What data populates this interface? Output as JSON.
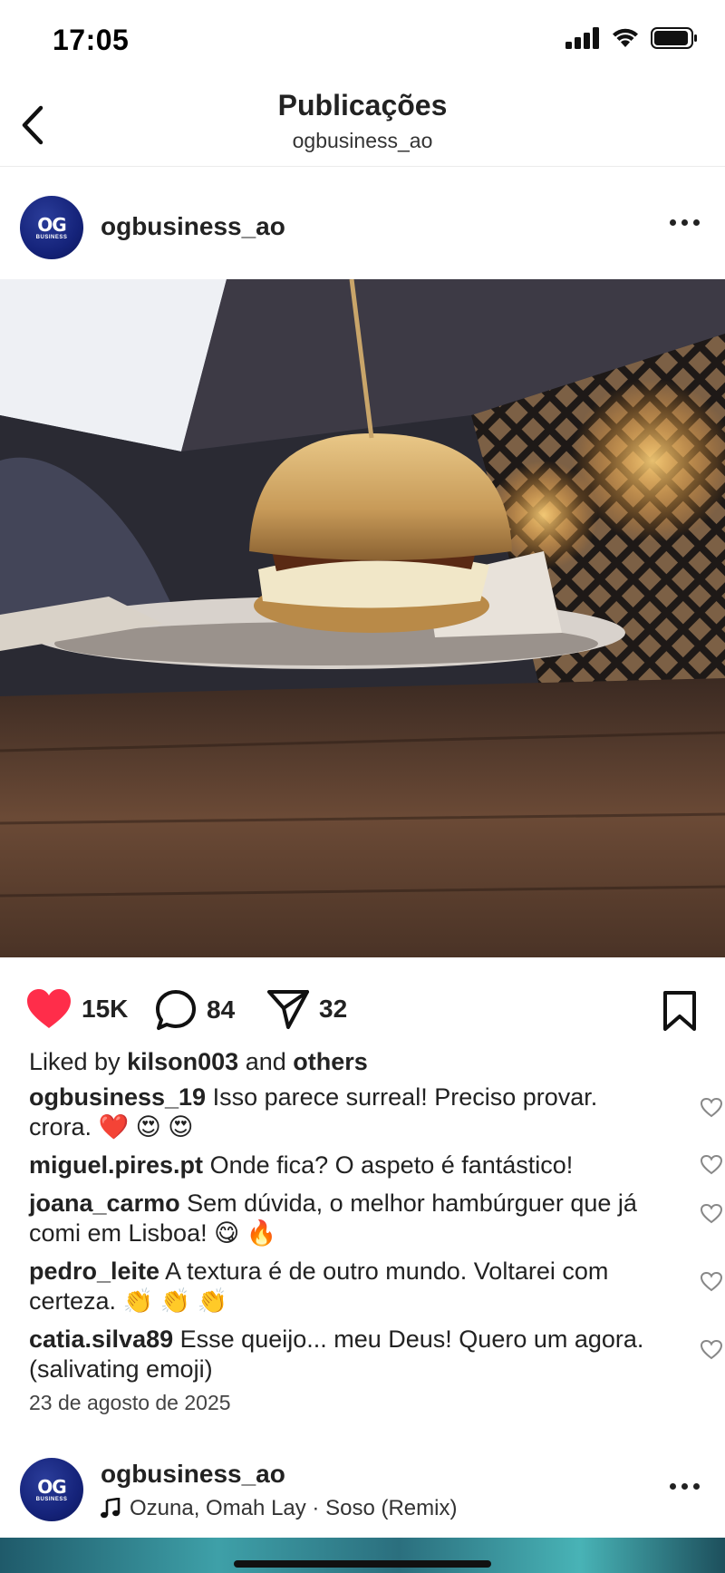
{
  "status_bar": {
    "time": "17:05"
  },
  "nav": {
    "title": "Publicações",
    "subtitle": "ogbusiness_ao"
  },
  "post": {
    "avatar_text": "OG",
    "avatar_subtext": "BUSINESS",
    "username": "ogbusiness_ao",
    "likes_count": "15K",
    "comments_count": "84",
    "shares_count": "32",
    "liked_by_prefix": "Liked by",
    "liked_by_user": "kilson003",
    "liked_by_and": "and",
    "liked_by_others": "others",
    "comments": [
      {
        "user": "ogbusiness_19",
        "text": "Isso parece surreal! Preciso provar. crora. ❤️ 😍 😍"
      },
      {
        "user": "miguel.pires.pt",
        "text": "Onde fica? O aspeto é fantástico!"
      },
      {
        "user": "joana_carmo",
        "text": "Sem dúvida, o melhor hambúrguer que já comi em Lisboa! 😋 🔥"
      },
      {
        "user": "pedro_leite",
        "text": "A textura é de outro mundo. Voltarei com certeza. 👏 👏 👏"
      },
      {
        "user": "catia.silva89",
        "text": "Esse queijo... meu Deus! Quero um agora. (salivating emoji)"
      }
    ],
    "date": "23 de agosto de 2025"
  },
  "next_post": {
    "username": "ogbusiness_ao",
    "music": "Ozuna, Omah Lay · Soso (Remix)"
  },
  "colors": {
    "like_red": "#ff2d4a",
    "avatar_blue": "#15237a"
  }
}
